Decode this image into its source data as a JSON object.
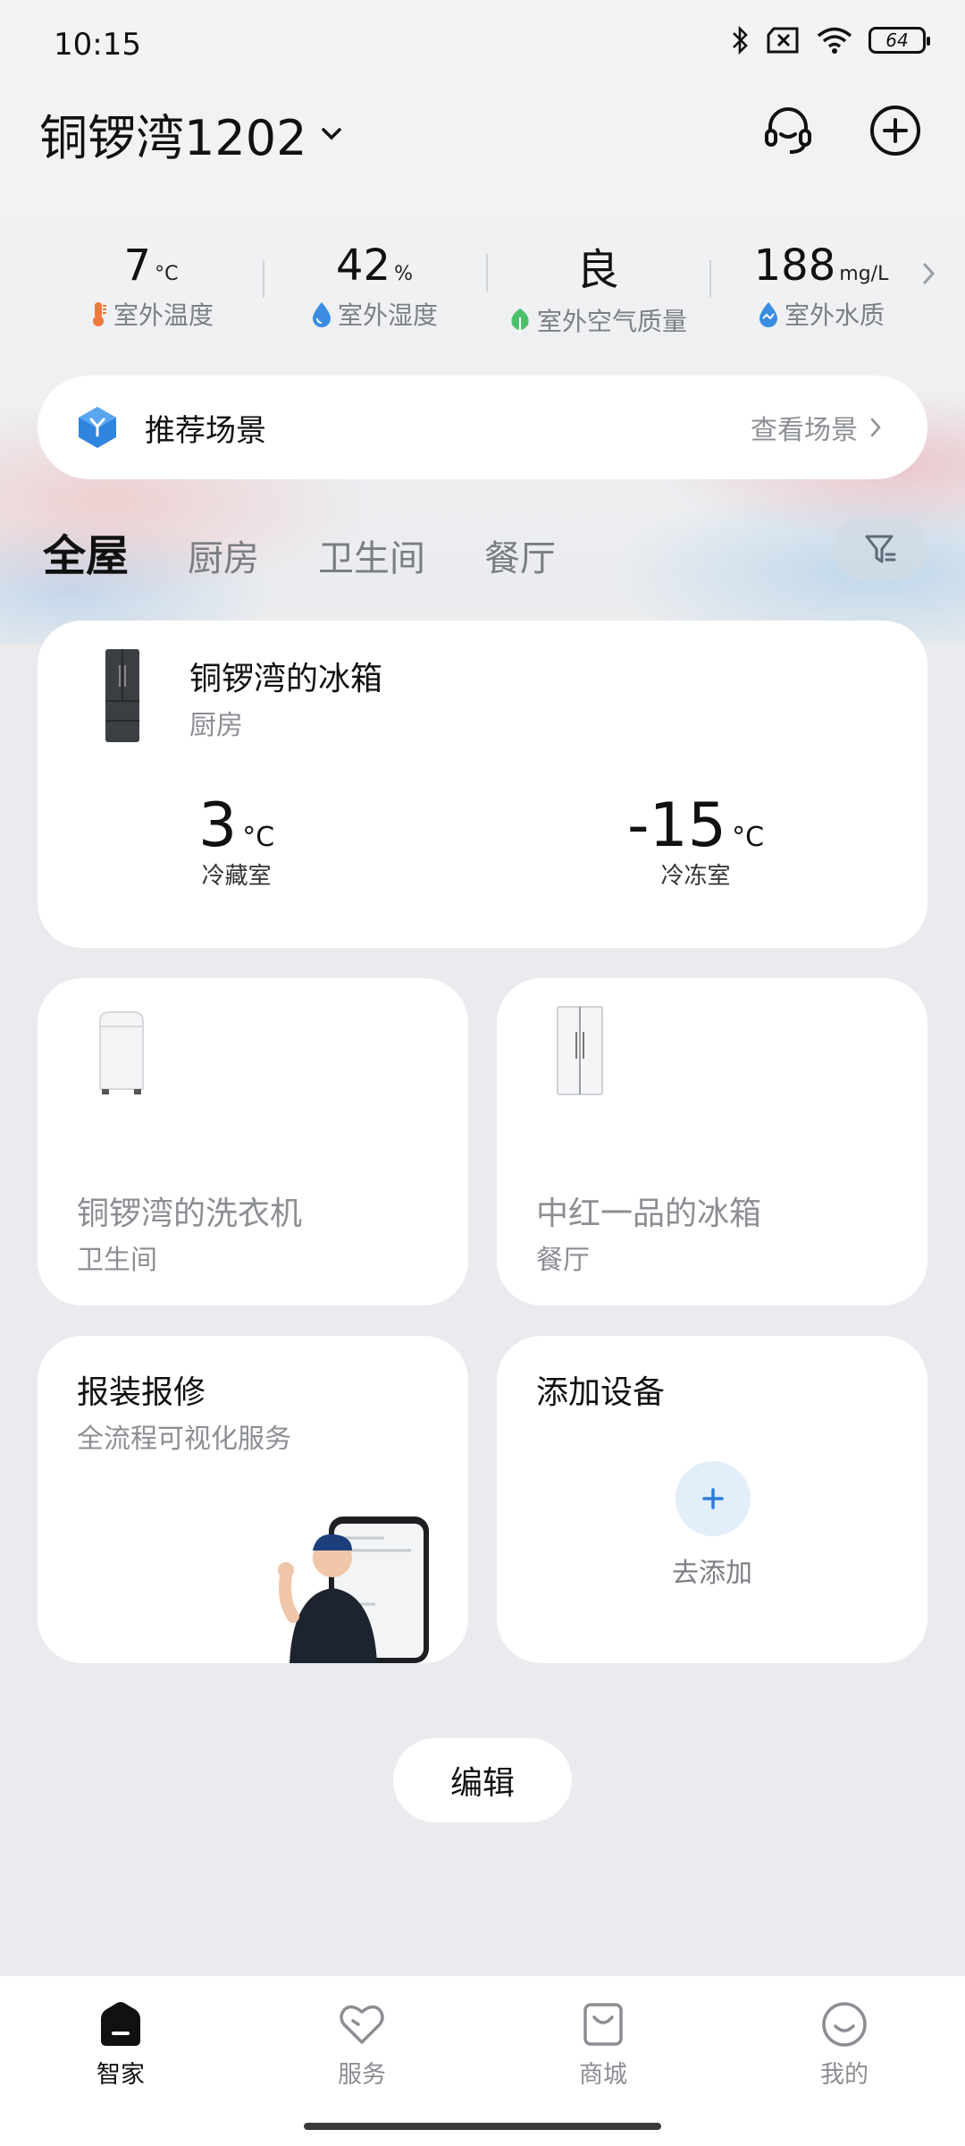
{
  "status_bar": {
    "time": "10:15",
    "battery": "64"
  },
  "header": {
    "home_name": "铜锣湾1202"
  },
  "environment": [
    {
      "value": "7",
      "unit": "°C",
      "label": "室外温度",
      "icon": "thermometer-icon",
      "color": "#f07a3c"
    },
    {
      "value": "42",
      "unit": "%",
      "label": "室外湿度",
      "icon": "water-drop-icon",
      "color": "#3a8de0"
    },
    {
      "value": "良",
      "unit": "",
      "label": "室外空气质量",
      "icon": "leaf-icon",
      "color": "#4cbf6a"
    },
    {
      "value": "188",
      "unit": "mg/L",
      "label": "室外水质",
      "icon": "water-quality-icon",
      "color": "#3a8de0"
    }
  ],
  "scene": {
    "title": "推荐场景",
    "link": "查看场景"
  },
  "tabs": [
    "全屋",
    "厨房",
    "卫生间",
    "餐厅"
  ],
  "devices": {
    "fridge_main": {
      "name": "铜锣湾的冰箱",
      "room": "厨房",
      "fridge_temp": "3",
      "fridge_label": "冷藏室",
      "freezer_temp": "-15",
      "freezer_label": "冷冻室",
      "unit": "°C"
    },
    "washer": {
      "name": "铜锣湾的洗衣机",
      "room": "卫生间"
    },
    "fridge_second": {
      "name": "中红一品的冰箱",
      "room": "餐厅"
    }
  },
  "service_card": {
    "title": "报装报修",
    "subtitle": "全流程可视化服务"
  },
  "add_card": {
    "title": "添加设备",
    "action": "去添加"
  },
  "edit_label": "编辑",
  "nav": [
    {
      "label": "智家",
      "icon": "home-icon",
      "active": true
    },
    {
      "label": "服务",
      "icon": "heart-icon",
      "active": false
    },
    {
      "label": "商城",
      "icon": "shopping-bag-icon",
      "active": false
    },
    {
      "label": "我的",
      "icon": "profile-smile-icon",
      "active": false
    }
  ],
  "colors": {
    "accent": "#2e7cd6",
    "background": "#e9ebee",
    "card": "#ffffff"
  }
}
